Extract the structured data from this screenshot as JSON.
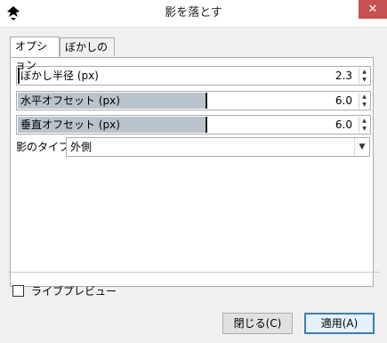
{
  "window": {
    "title": "影を落とす",
    "close_label": "✕"
  },
  "tabs": [
    {
      "label": "オプション",
      "active": true
    },
    {
      "label": "ぼかしの色",
      "active": false
    }
  ],
  "options": {
    "blur": {
      "label": "ぼかし半径 (px)",
      "value": "2.3",
      "fill": 0
    },
    "horizontal": {
      "label": "水平オフセット (px)",
      "value": "6.0",
      "fill": 0.55
    },
    "vertical": {
      "label": "垂直オフセット (px)",
      "value": "6.0",
      "fill": 0.55
    },
    "type": {
      "label": "影のタイプ:",
      "value": "外側"
    }
  },
  "live_preview": {
    "label": "ライブプレビュー",
    "checked": false
  },
  "buttons": {
    "close": "閉じる(C)",
    "apply": "適用(A)"
  },
  "colors": {
    "close_button": "#c75050",
    "slider_fill": "#b9c3cb",
    "default_button_border": "#3c7fb1"
  }
}
